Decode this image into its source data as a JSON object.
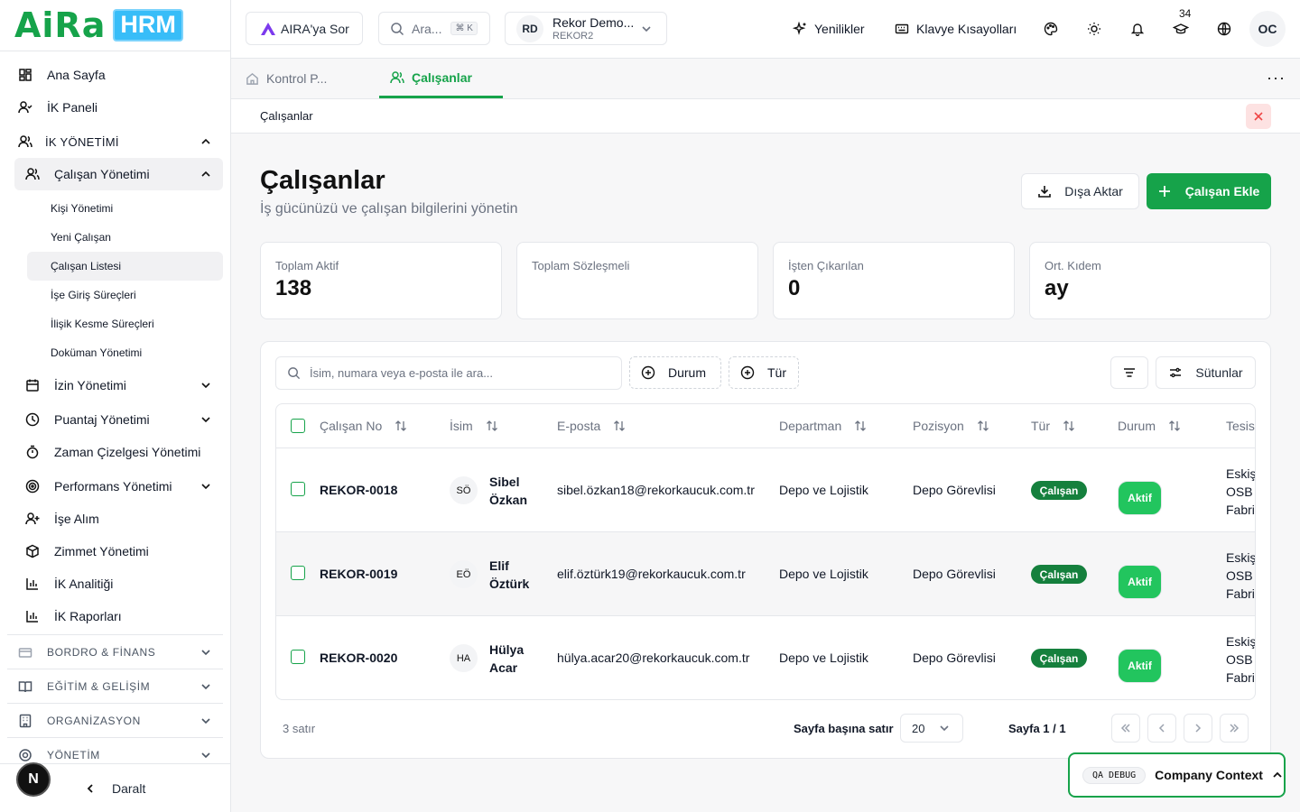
{
  "brand": {
    "logo_text": "AiRa",
    "logo_badge": "HRM"
  },
  "sidebar": {
    "items": [
      {
        "label": "Ana Sayfa"
      },
      {
        "label": "İK Paneli"
      }
    ],
    "group_ik": {
      "label": "İK YÖNETİMİ"
    },
    "employee_mgmt": {
      "label": "Çalışan Yönetimi"
    },
    "sub_items": [
      {
        "label": "Kişi Yönetimi"
      },
      {
        "label": "Yeni Çalışan"
      },
      {
        "label": "Çalışan Listesi"
      },
      {
        "label": "İşe Giriş Süreçleri"
      },
      {
        "label": "İlişik Kesme Süreçleri"
      },
      {
        "label": "Doküman Yönetimi"
      }
    ],
    "modules": [
      {
        "label": "İzin Yönetimi"
      },
      {
        "label": "Puantaj Yönetimi"
      },
      {
        "label": "Zaman Çizelgesi Yönetimi"
      },
      {
        "label": "Performans Yönetimi"
      },
      {
        "label": "İşe Alım"
      },
      {
        "label": "Zimmet Yönetimi"
      },
      {
        "label": "İK Analitiği"
      },
      {
        "label": "İK Raporları"
      }
    ],
    "sections": [
      {
        "label": "BORDRO & FİNANS"
      },
      {
        "label": "EĞİTİM & GELİŞİM"
      },
      {
        "label": "ORGANİZASYON"
      },
      {
        "label": "YÖNETİM"
      }
    ],
    "collapse_label": "Daralt",
    "n_badge": "N"
  },
  "topbar": {
    "ask_aira": "AIRA'ya Sor",
    "search_placeholder": "Ara...",
    "search_shortcut": "⌘ K",
    "company_initials": "RD",
    "company_name": "Rekor Demo...",
    "company_code": "REKOR2",
    "whats_new": "Yenilikler",
    "shortcuts": "Klavye Kısayolları",
    "training_count": "34",
    "user_initials": "OC"
  },
  "tabs": [
    {
      "label": "Kontrol P..."
    },
    {
      "label": "Çalışanlar"
    }
  ],
  "breadcrumb": "Çalışanlar",
  "page": {
    "title": "Çalışanlar",
    "subtitle": "İş gücünüzü ve çalışan bilgilerini yönetin",
    "export_label": "Dışa Aktar",
    "add_label": "Çalışan Ekle"
  },
  "stats": [
    {
      "label": "Toplam Aktif",
      "value": "138"
    },
    {
      "label": "Toplam Sözleşmeli",
      "value": ""
    },
    {
      "label": "İşten Çıkarılan",
      "value": "0"
    },
    {
      "label": "Ort. Kıdem",
      "value": "ay"
    }
  ],
  "filters": {
    "search_placeholder": "İsim, numara veya e-posta ile ara...",
    "status_chip": "Durum",
    "type_chip": "Tür",
    "columns_label": "Sütunlar"
  },
  "table": {
    "columns": [
      "Çalışan No",
      "İsim",
      "E-posta",
      "Departman",
      "Pozisyon",
      "Tür",
      "Durum",
      "Tesis"
    ],
    "rows": [
      {
        "no": "REKOR-0018",
        "initials": "SÖ",
        "name": "Sibel Özkan",
        "email": "sibel.özkan18@rekorkaucuk.com.tr",
        "department": "Depo ve Lojistik",
        "position": "Depo Görevlisi",
        "type": "Çalışan",
        "status": "Aktif",
        "facility": "Eskişehir\nOSB\nFabrika"
      },
      {
        "no": "REKOR-0019",
        "initials": "EÖ",
        "name": "Elif Öztürk",
        "email": "elif.öztürk19@rekorkaucuk.com.tr",
        "department": "Depo ve Lojistik",
        "position": "Depo Görevlisi",
        "type": "Çalışan",
        "status": "Aktif",
        "facility": "Eskişehir\nOSB\nFabrika"
      },
      {
        "no": "REKOR-0020",
        "initials": "HA",
        "name": "Hülya Acar",
        "email": "hülya.acar20@rekorkaucuk.com.tr",
        "department": "Depo ve Lojistik",
        "position": "Depo Görevlisi",
        "type": "Çalışan",
        "status": "Aktif",
        "facility": "Eskişehir\nOSB\nFabrika"
      }
    ]
  },
  "pagination": {
    "row_count": "3 satır",
    "rows_per_page_label": "Sayfa başına satır",
    "rows_per_page": "20",
    "page_label": "Sayfa 1 / 1"
  },
  "debug": {
    "badge": "QA DEBUG",
    "label": "Company Context"
  },
  "colors": {
    "brand_green": "#16a34a",
    "status_green": "#22c55e",
    "type_green": "#15803d",
    "logo_badge": "#38bdf8",
    "close_red": "#ef4444"
  }
}
